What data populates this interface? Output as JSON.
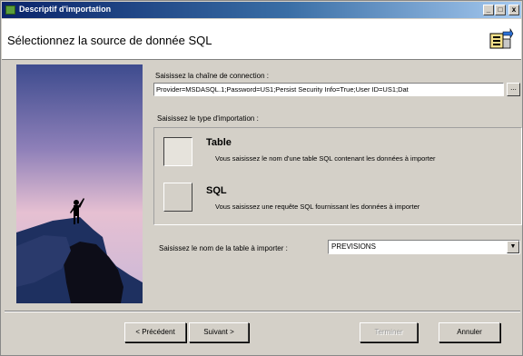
{
  "window": {
    "title": "Descriptif d'importation",
    "controls": {
      "minimize": "_",
      "maximize": "□",
      "close": "x"
    }
  },
  "header": {
    "title": "Sélectionnez la source de donnée SQL",
    "icon": "import-wizard-icon"
  },
  "connection": {
    "label": "Saisissez la chaîne de connection :",
    "value": "Provider=MSDASQL.1;Password=US1;Persist Security Info=True;User ID=US1;Dat",
    "browse_label": "..."
  },
  "import_type": {
    "label": "Saisissez le type d'importation :",
    "options": [
      {
        "title": "Table",
        "description": "Vous saisissez le nom d'une table SQL contenant les données à importer",
        "selected": true
      },
      {
        "title": "SQL",
        "description": "Vous saisissez une requête SQL fournissant les données à importer",
        "selected": false
      }
    ]
  },
  "table_name": {
    "label": "Saisissez le nom de la table à importer :",
    "selected_value": "PREVISIONS",
    "dropdown_icon": "chevron-down-icon"
  },
  "footer": {
    "back_label": "< Précédent",
    "next_label": "Suivant >",
    "finish_label": "Terminer",
    "cancel_label": "Annuler"
  },
  "colors": {
    "titlebar_start": "#0a246a",
    "titlebar_end": "#a6caf0",
    "window_bg": "#d4d0c8"
  }
}
